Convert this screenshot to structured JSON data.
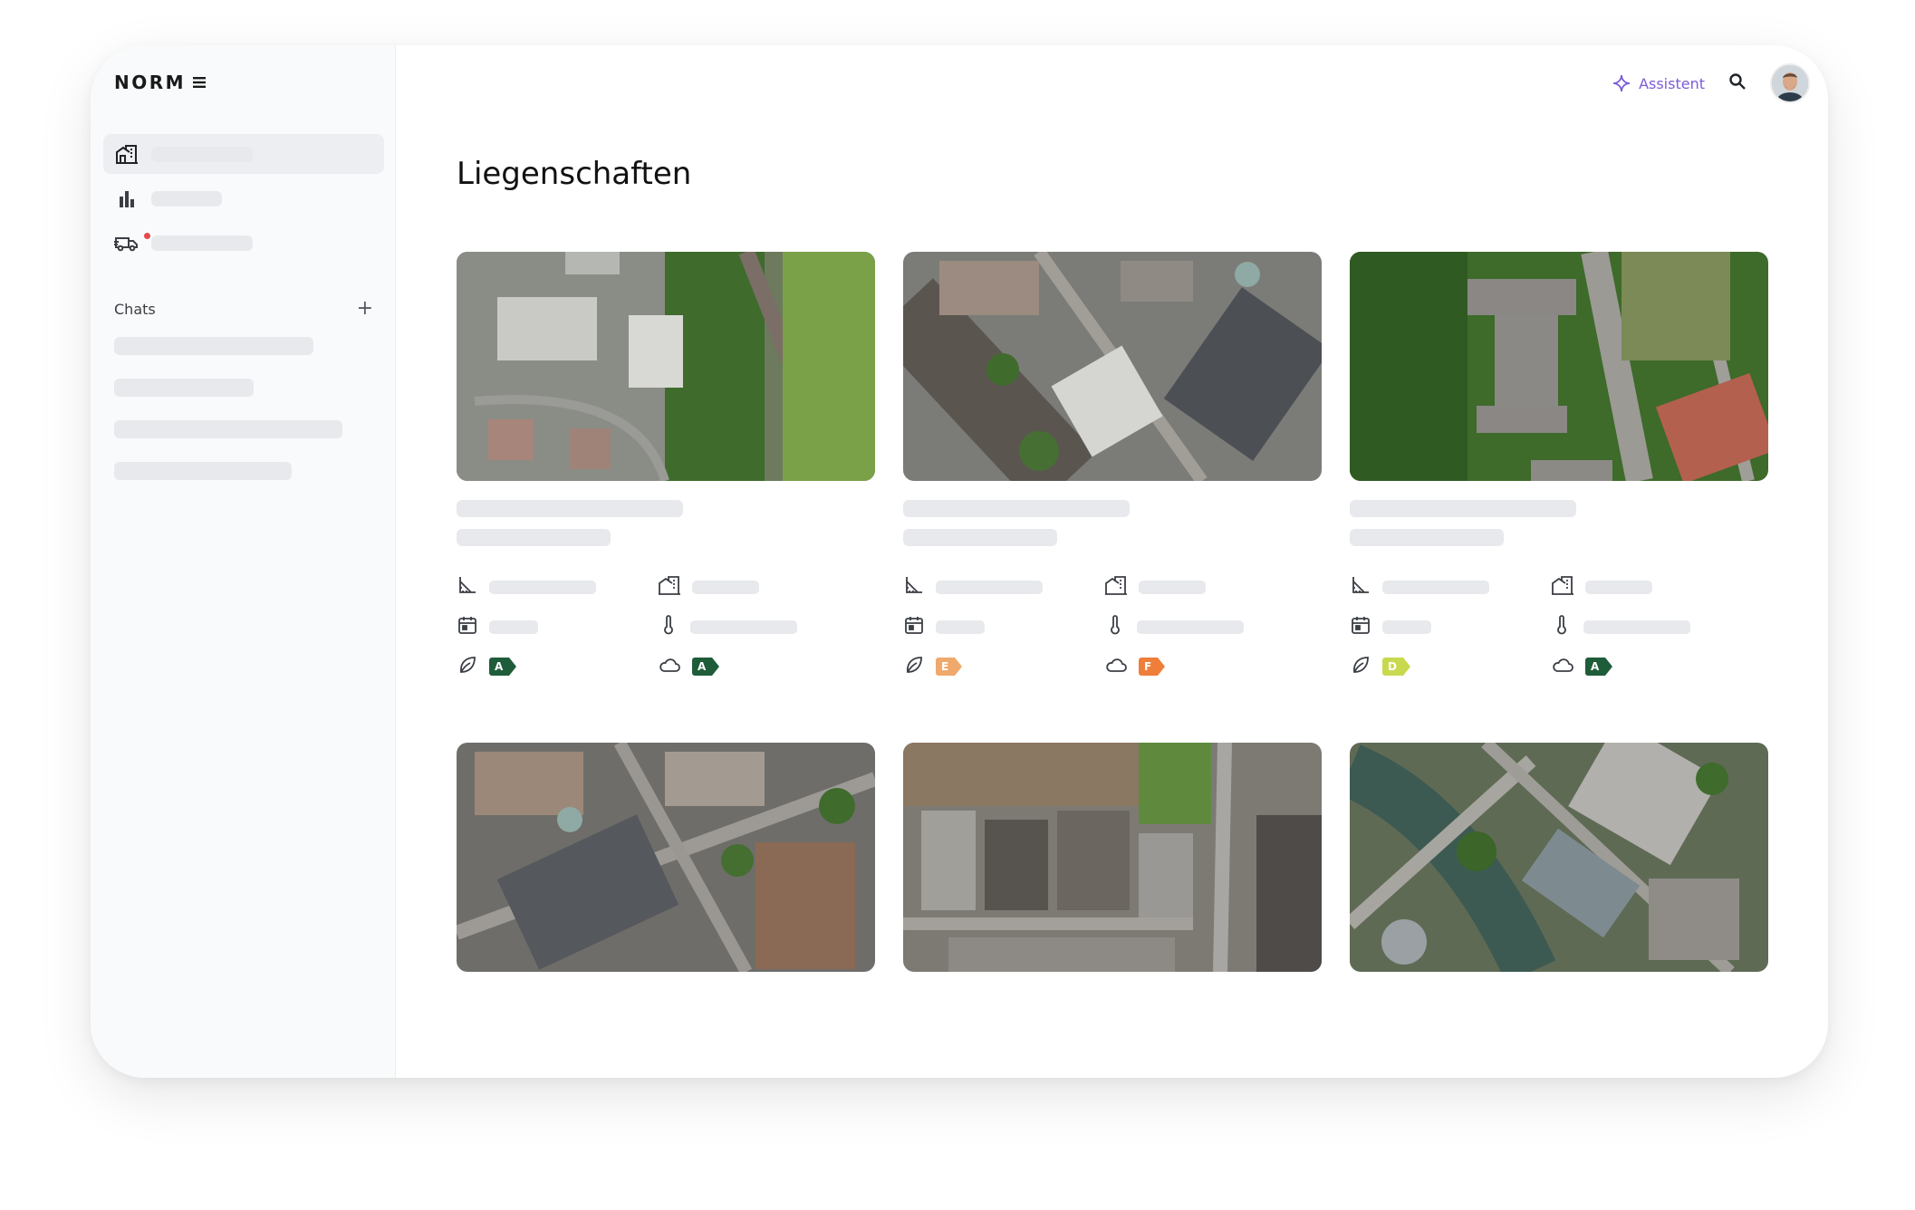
{
  "app": {
    "logo_text": "NORM"
  },
  "sidebar": {
    "nav_items": [
      {
        "icon": "building-icon",
        "active": true
      },
      {
        "icon": "bar-chart-icon",
        "active": false
      },
      {
        "icon": "truck-icon",
        "active": false,
        "notification": true
      }
    ],
    "chats_label": "Chats",
    "add_chat_symbol": "+",
    "chat_items_count": 4
  },
  "topbar": {
    "assistant_label": "Assistent",
    "assistant_color": "#7d5bd6"
  },
  "page_title": "Liegenschaften",
  "rating_colors": {
    "A": "#1f5c3a",
    "E": "#efa96c",
    "F": "#ee7e3a",
    "D": "#c8d94f"
  },
  "properties": [
    {
      "image": "aerial-view-1",
      "efficiency_rating": "A",
      "emissions_rating": "A"
    },
    {
      "image": "aerial-view-2",
      "efficiency_rating": "E",
      "emissions_rating": "F"
    },
    {
      "image": "aerial-view-3",
      "efficiency_rating": "D",
      "emissions_rating": "A"
    },
    {
      "image": "aerial-view-4"
    },
    {
      "image": "aerial-view-5"
    },
    {
      "image": "aerial-view-6"
    }
  ]
}
